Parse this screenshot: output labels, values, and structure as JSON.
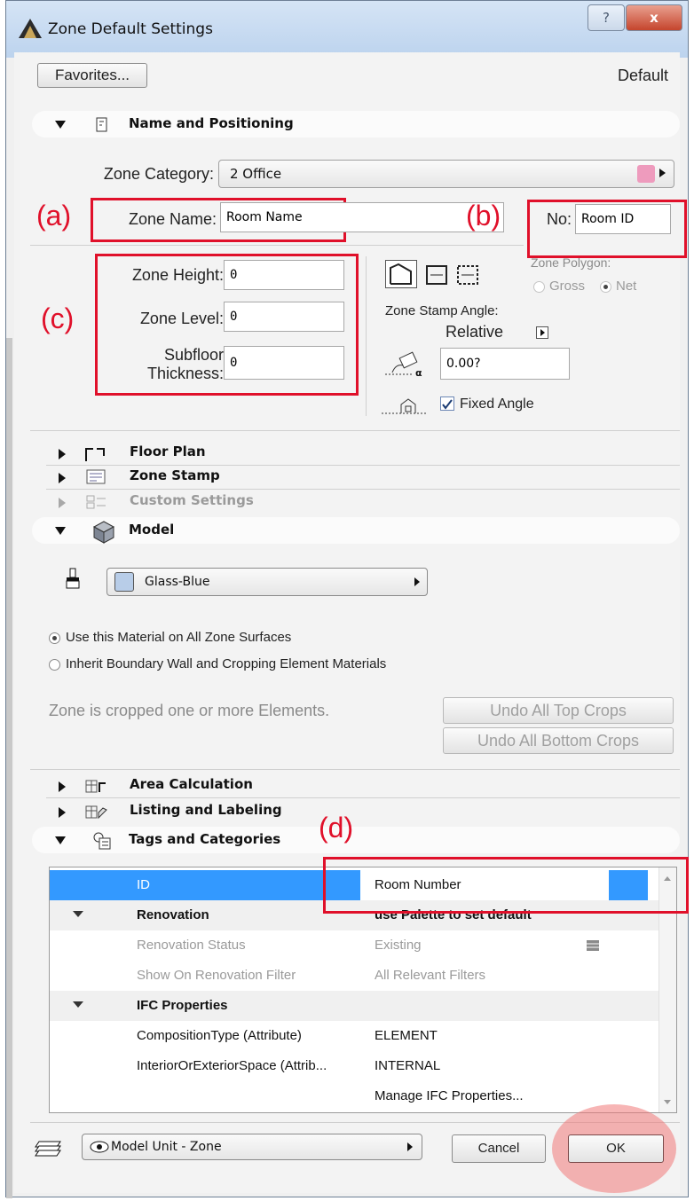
{
  "window": {
    "title": "Zone Default Settings",
    "help_glyph": "?",
    "close_glyph": "x"
  },
  "top": {
    "favorites_label": "Favorites...",
    "default_label": "Default"
  },
  "sections": {
    "name_positioning": "Name and Positioning",
    "floor_plan": "Floor Plan",
    "zone_stamp": "Zone Stamp",
    "custom_settings": "Custom Settings",
    "model": "Model",
    "area_calc": "Area Calculation",
    "listing": "Listing and Labeling",
    "tags": "Tags and Categories"
  },
  "positioning": {
    "category_label": "Zone Category:",
    "category_value": "2  Office",
    "category_color": "#ee9bbd",
    "name_label": "Zone Name:",
    "name_value": "Room Name",
    "no_label": "No:",
    "no_value": "Room ID",
    "height_label": "Zone Height:",
    "height_value": "0",
    "level_label": "Zone Level:",
    "level_value": "0",
    "subfloor_label_1": "Subfloor",
    "subfloor_label_2": "Thickness:",
    "subfloor_value": "0",
    "polygon_label": "Zone Polygon:",
    "gross_label": "Gross",
    "net_label": "Net",
    "polygon_selected": "Net",
    "stamp_angle_label": "Zone Stamp Angle:",
    "relative_label": "Relative",
    "angle_value": "0.00?",
    "fixed_angle_label": "Fixed Angle",
    "fixed_angle_checked": true
  },
  "model": {
    "material_name": "Glass-Blue",
    "material_color": "#b8cde8",
    "option_1": "Use this Material on All Zone Surfaces",
    "option_2": "Inherit Boundary Wall and Cropping Element Materials",
    "selected_option": 1,
    "cropped_text": "Zone is cropped one or more Elements.",
    "undo_top": "Undo All Top Crops",
    "undo_bottom": "Undo All Bottom Crops"
  },
  "tags_table": {
    "rows": [
      {
        "name": "ID",
        "value": "Room Number",
        "kind": "selected"
      },
      {
        "name": "Renovation",
        "value": "use Palette to set default",
        "kind": "group"
      },
      {
        "name": "Renovation Status",
        "value": "Existing",
        "kind": "disabled"
      },
      {
        "name": "Show On Renovation Filter",
        "value": "All Relevant Filters",
        "kind": "disabled"
      },
      {
        "name": "IFC Properties",
        "value": "",
        "kind": "group"
      },
      {
        "name": "CompositionType (Attribute)",
        "value": "ELEMENT",
        "kind": "normal"
      },
      {
        "name": "InteriorOrExteriorSpace (Attrib...",
        "value": "INTERNAL",
        "kind": "normal"
      },
      {
        "name": "",
        "value": "Manage IFC Properties...",
        "kind": "normal"
      }
    ]
  },
  "footer": {
    "view_value": "Model Unit - Zone",
    "cancel_label": "Cancel",
    "ok_label": "OK"
  },
  "annotations": {
    "a": "(a)",
    "b": "(b)",
    "c": "(c)",
    "d": "(d)"
  },
  "colors": {
    "annotation_red": "#e0102a",
    "selection_blue": "#3399ff",
    "ok_highlight": "#f08c8c"
  }
}
